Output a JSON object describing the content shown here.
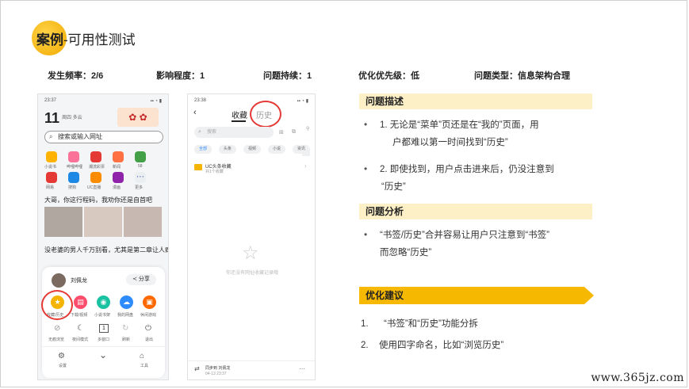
{
  "header": {
    "title_main": "案例",
    "title_sub": "-可用性测试"
  },
  "meta": [
    "发生频率：2/6",
    "影响程度：1",
    "问题持续：1",
    "优化优先级：低",
    "问题类型：信息架构合理"
  ],
  "phone1": {
    "time": "23:37",
    "date_day": "11",
    "date_text": "周四 多云",
    "search_placeholder": "搜索或输入网址",
    "apps_row1": [
      "小说书",
      "哔哩哔哩",
      "潮流彩票",
      "新闻",
      "58"
    ],
    "apps_row2": [
      "网易",
      "搜狗",
      "UC直播",
      "漫画",
      "更多"
    ],
    "news1": "大哥，你这行程码，我劝你还是自首吧",
    "news2": "没老婆的男人千万别看，尤其是第二章让人疯狂尖叫，盼你停不下来",
    "user_name": "刘佩龙",
    "share_label": "分享",
    "menu_row1": [
      "收藏/历史",
      "下载/视频",
      "小说书架",
      "我的网盘",
      "休闲游戏"
    ],
    "menu_row2": [
      "无痕浏览",
      "夜间模式",
      "多窗口",
      "刷新",
      "退出"
    ],
    "bottom": [
      "设置",
      "",
      "工具"
    ],
    "window_count": "1",
    "colors": {
      "fav": "#f5b400",
      "dl": "#ff4d6d",
      "novel": "#19c2a0",
      "disk": "#2f8cff",
      "game": "#ff6a00"
    }
  },
  "phone2": {
    "time": "23:38",
    "tab_fav": "收藏",
    "tab_history": "历史",
    "search_placeholder": "搜索",
    "chips": [
      "全部",
      "头条",
      "视频",
      "小说",
      "资讯"
    ],
    "folder_title": "UC头条收藏",
    "folder_sub": "共1个收藏",
    "empty_text": "你还没有网址收藏记录哦",
    "sync_title": "同步到 刘佩龙",
    "sync_time": "04-13 23:37"
  },
  "problem": {
    "heading": "问题描述",
    "items": [
      [
        "1. 无论是“菜单”页还是在“我的”页面，用",
        "户都难以第一时间找到“历史”"
      ],
      [
        "2. 即使找到，用户点击进来后，仍没注意到",
        "“历史”"
      ]
    ]
  },
  "analysis": {
    "heading": "问题分析",
    "items": [
      [
        "“书签/历史”合并容易让用户只注意到“书签”",
        "而忽略“历史”"
      ]
    ]
  },
  "optimize": {
    "heading": "优化建议",
    "items": [
      {
        "num": "1.",
        "text": "“书签”和“历史”功能分拆"
      },
      {
        "num": "2.",
        "text": "使用四字命名，比如“浏览历史”"
      }
    ]
  },
  "watermark": "www.365jz.com"
}
